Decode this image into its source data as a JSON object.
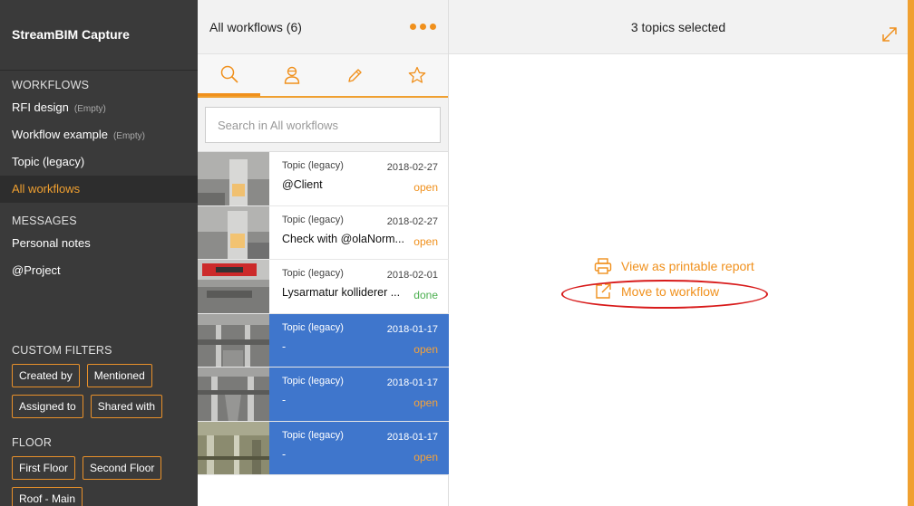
{
  "sidebar": {
    "app_title": "StreamBIM Capture",
    "workflows_header": "WORKFLOWS",
    "workflows": [
      {
        "label": "RFI design",
        "note": "(Empty)"
      },
      {
        "label": "Workflow example",
        "note": "(Empty)"
      },
      {
        "label": "Topic (legacy)",
        "note": ""
      },
      {
        "label": "All workflows",
        "note": ""
      }
    ],
    "messages_header": "MESSAGES",
    "messages": [
      "Personal notes",
      "@Project"
    ],
    "custom_filters_header": "CUSTOM FILTERS",
    "custom_filters": [
      "Created by",
      "Mentioned",
      "Assigned to",
      "Shared with"
    ],
    "floor_header": "FLOOR",
    "floors": [
      "First Floor",
      "Second Floor",
      "Roof - Main"
    ]
  },
  "list": {
    "title": "All workflows (6)",
    "tabs": [
      "search-icon",
      "person-icon",
      "pencil-icon",
      "star-icon"
    ],
    "search_placeholder": "Search in All workflows",
    "items": [
      {
        "type": "Topic (legacy)",
        "date": "2018-02-27",
        "title": "@Client",
        "status": "open",
        "selected": false
      },
      {
        "type": "Topic (legacy)",
        "date": "2018-02-27",
        "title": "Check with @olaNorm...",
        "status": "open",
        "selected": false
      },
      {
        "type": "Topic (legacy)",
        "date": "2018-02-01",
        "title": "Lysarmatur kolliderer ...",
        "status": "done",
        "selected": false
      },
      {
        "type": "Topic (legacy)",
        "date": "2018-01-17",
        "title": "-",
        "status": "open",
        "selected": true
      },
      {
        "type": "Topic (legacy)",
        "date": "2018-01-17",
        "title": "-",
        "status": "open",
        "selected": true
      },
      {
        "type": "Topic (legacy)",
        "date": "2018-01-17",
        "title": "-",
        "status": "open",
        "selected": true
      }
    ]
  },
  "detail": {
    "title": "3 topics selected",
    "actions": {
      "print_label": "View as printable report",
      "move_label": "Move to workflow"
    }
  },
  "colors": {
    "accent": "#f0901c",
    "selected_row": "#3f76cc",
    "sidebar_bg": "#3a3a3a",
    "done": "#4caf50",
    "highlight_ring": "#d81b1b"
  }
}
